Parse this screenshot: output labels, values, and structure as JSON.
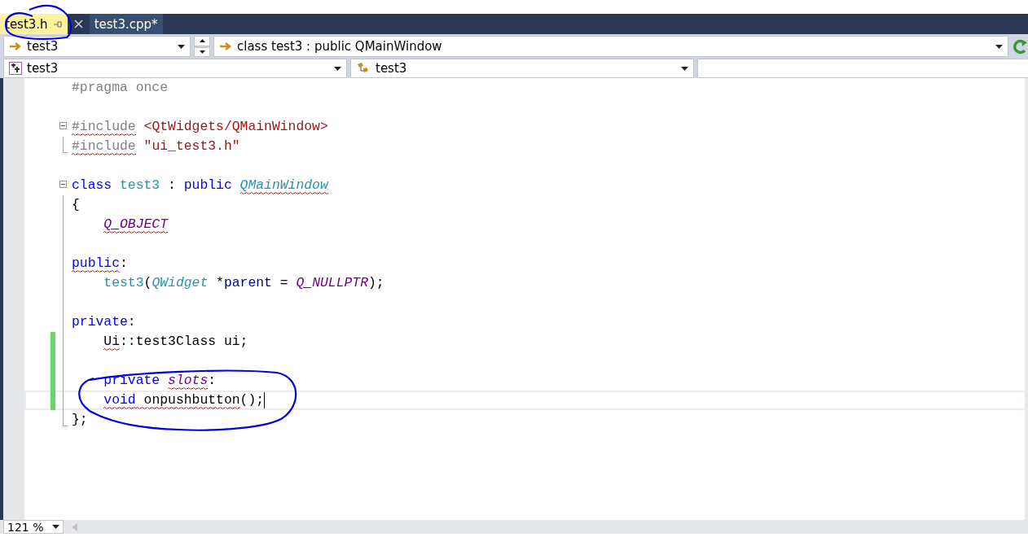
{
  "tabs": [
    {
      "label": "test3.h",
      "selected": true,
      "pinned": true
    },
    {
      "label": "test3.cpp*",
      "selected": false,
      "pinned": false
    }
  ],
  "nav_bar": {
    "project": "test3",
    "scope": "class test3 : public QMainWindow",
    "type": "test3",
    "member": "test3"
  },
  "editor": {
    "lines": [
      {
        "kind": "plain",
        "changed": false,
        "current": false,
        "caret": false,
        "indent": false,
        "tokens": [
          {
            "text": "#pragma once",
            "kind": "preproc",
            "squiggle": false
          }
        ]
      },
      {
        "kind": "plain",
        "changed": false,
        "current": false,
        "caret": false
      },
      {
        "kind": "fold-start",
        "changed": false,
        "current": false,
        "caret": false,
        "indent": false,
        "tokens": [
          {
            "text": "#include",
            "kind": "preproc",
            "squiggle": true
          },
          {
            "text": " <QtWidgets/QMainWindow>",
            "kind": "string",
            "squiggle": false
          }
        ]
      },
      {
        "kind": "fold-end",
        "changed": false,
        "current": false,
        "caret": false,
        "indent": false,
        "tokens": [
          {
            "text": "#include",
            "kind": "preproc",
            "squiggle": true
          },
          {
            "text": " \"ui_test3.h\"",
            "kind": "string",
            "squiggle": false
          }
        ]
      },
      {
        "kind": "plain",
        "changed": false,
        "current": false,
        "caret": false
      },
      {
        "kind": "fold-start",
        "changed": false,
        "current": false,
        "caret": false,
        "indent": false,
        "tokens": [
          {
            "text": "class",
            "kind": "keyword",
            "squiggle": false
          },
          {
            "text": " test3",
            "kind": "type",
            "squiggle": false
          },
          {
            "text": " : ",
            "kind": "plain",
            "squiggle": false
          },
          {
            "text": "public ",
            "kind": "keyword",
            "squiggle": false
          },
          {
            "text": "QMainWindow",
            "kind": "type-italic",
            "squiggle": true
          }
        ]
      },
      {
        "kind": "fold-body",
        "changed": false,
        "current": false,
        "caret": false,
        "indent": false,
        "tokens": [
          {
            "text": "{",
            "kind": "plain",
            "squiggle": false
          }
        ]
      },
      {
        "kind": "fold-body",
        "changed": false,
        "current": false,
        "caret": false,
        "indent": true,
        "tokens": [
          {
            "text": "Q_OBJECT",
            "kind": "macro",
            "squiggle": true
          }
        ]
      },
      {
        "kind": "fold-body",
        "changed": false,
        "current": false,
        "caret": false
      },
      {
        "kind": "fold-body",
        "changed": false,
        "current": false,
        "caret": false,
        "indent": false,
        "tokens": [
          {
            "text": "public",
            "kind": "keyword",
            "squiggle": true
          },
          {
            "text": ":",
            "kind": "plain",
            "squiggle": false
          }
        ]
      },
      {
        "kind": "fold-body",
        "changed": false,
        "current": false,
        "caret": false,
        "indent": true,
        "tokens": [
          {
            "text": "test3",
            "kind": "type",
            "squiggle": false
          },
          {
            "text": "(",
            "kind": "plain",
            "squiggle": false
          },
          {
            "text": "QWidget",
            "kind": "type-italic",
            "squiggle": false
          },
          {
            "text": " *",
            "kind": "plain",
            "squiggle": false
          },
          {
            "text": "parent",
            "kind": "param",
            "squiggle": false
          },
          {
            "text": " = ",
            "kind": "plain",
            "squiggle": false
          },
          {
            "text": "Q_NULLPTR",
            "kind": "macro",
            "squiggle": false
          },
          {
            "text": ");",
            "kind": "plain",
            "squiggle": false
          }
        ]
      },
      {
        "kind": "fold-body",
        "changed": false,
        "current": false,
        "caret": false
      },
      {
        "kind": "fold-body",
        "changed": false,
        "current": false,
        "caret": false,
        "indent": false,
        "tokens": [
          {
            "text": "private",
            "kind": "keyword",
            "squiggle": false
          },
          {
            "text": ":",
            "kind": "plain",
            "squiggle": false
          }
        ]
      },
      {
        "kind": "fold-body",
        "changed": true,
        "current": false,
        "caret": false,
        "indent": true,
        "tokens": [
          {
            "text": "Ui",
            "kind": "plain",
            "squiggle": true
          },
          {
            "text": "::test3Class ui;",
            "kind": "plain",
            "squiggle": false
          }
        ]
      },
      {
        "kind": "fold-body",
        "changed": true,
        "current": false,
        "caret": false
      },
      {
        "kind": "fold-body",
        "changed": true,
        "current": false,
        "caret": false,
        "indent": true,
        "tokens": [
          {
            "text": "private ",
            "kind": "keyword",
            "squiggle": false
          },
          {
            "text": "slots",
            "kind": "macro",
            "squiggle": true
          },
          {
            "text": ":",
            "kind": "plain",
            "squiggle": false
          }
        ]
      },
      {
        "kind": "fold-body",
        "changed": true,
        "current": true,
        "caret": true,
        "indent": true,
        "tokens": [
          {
            "text": "void",
            "kind": "keyword",
            "squiggle": true
          },
          {
            "text": " onpushbutton",
            "kind": "plain",
            "squiggle": true
          },
          {
            "text": "();",
            "kind": "plain",
            "squiggle": false
          }
        ]
      },
      {
        "kind": "fold-end",
        "changed": false,
        "current": false,
        "caret": false,
        "indent": false,
        "tokens": [
          {
            "text": "};",
            "kind": "plain",
            "squiggle": false
          }
        ]
      }
    ]
  },
  "status_bar": {
    "zoom": "121 %"
  }
}
